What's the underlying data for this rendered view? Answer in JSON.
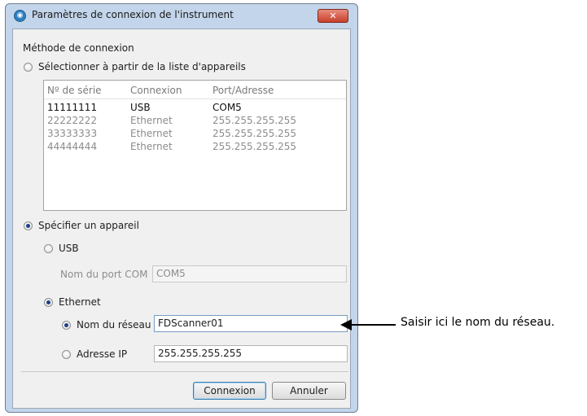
{
  "window": {
    "title": "Paramètres de connexion de l'instrument",
    "close_glyph": "✕"
  },
  "connection_method": {
    "heading": "Méthode de connexion",
    "from_list_label": "Sélectionner à partir de la liste d'appareils",
    "from_list_selected": false
  },
  "device_list": {
    "columns": [
      "Nº de série",
      "Connexion",
      "Port/Adresse"
    ],
    "rows": [
      {
        "serial": "11111111",
        "connection": "USB",
        "address": "COM5",
        "active": true
      },
      {
        "serial": "22222222",
        "connection": "Ethernet",
        "address": "255.255.255.255",
        "active": false
      },
      {
        "serial": "33333333",
        "connection": "Ethernet",
        "address": "255.255.255.255",
        "active": false
      },
      {
        "serial": "44444444",
        "connection": "Ethernet",
        "address": "255.255.255.255",
        "active": false
      }
    ]
  },
  "specify": {
    "label": "Spécifier un appareil",
    "selected": true,
    "usb": {
      "label": "USB",
      "selected": false,
      "com_port_label": "Nom du port COM",
      "com_port_value": "COM5"
    },
    "ethernet": {
      "label": "Ethernet",
      "selected": true,
      "network_name_label": "Nom du réseau",
      "network_name_value": "FDScanner01",
      "network_name_selected": true,
      "ip_label": "Adresse IP",
      "ip_value": "255.255.255.255",
      "ip_selected": false
    }
  },
  "buttons": {
    "connect": "Connexion",
    "cancel": "Annuler"
  },
  "annotation": {
    "text": "Saisir ici le nom du réseau."
  },
  "colors": {
    "title_bar": "#c3d5ea",
    "client_bg": "#f0f0f0",
    "close_button": "#c7402b",
    "radio_dot": "#1a3f8a",
    "default_button_border": "#3c7fb1"
  },
  "icons": {
    "app": "instrument-app-icon",
    "close": "close-icon"
  }
}
